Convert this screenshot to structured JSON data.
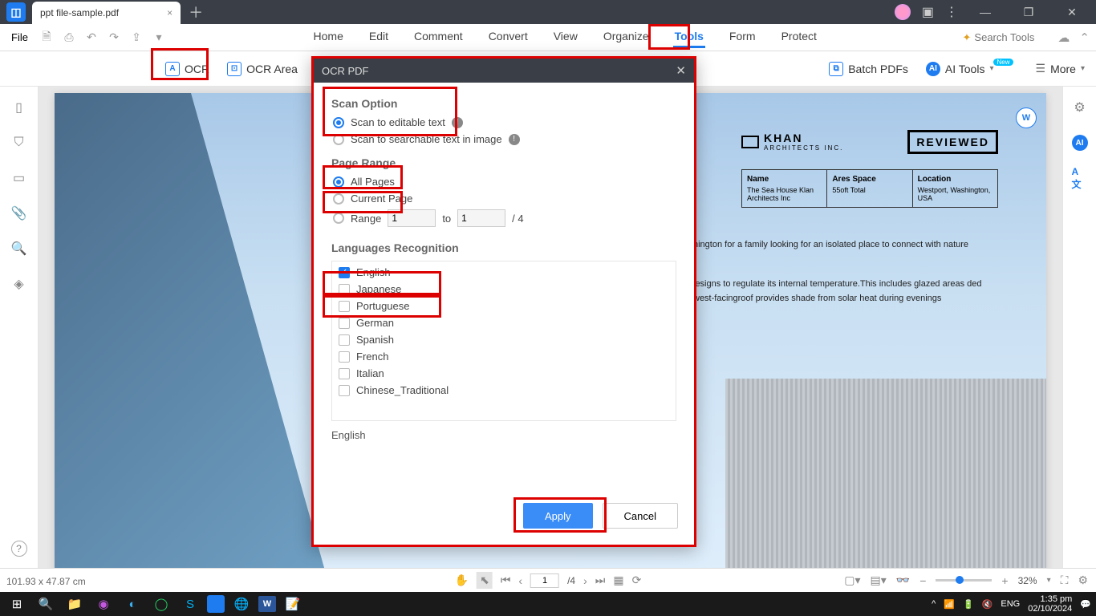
{
  "header": {
    "tab_title": "ppt file-sample.pdf",
    "search_placeholder": "Search Tools"
  },
  "menu": {
    "file": "File",
    "tabs": [
      "Home",
      "Edit",
      "Comment",
      "Convert",
      "View",
      "Organize",
      "Tools",
      "Form",
      "Protect"
    ],
    "active_tab": "Tools"
  },
  "ribbon": {
    "ocr": "OCR",
    "ocr_area": "OCR Area",
    "batch_pdfs": "Batch PDFs",
    "ai_tools": "AI Tools",
    "more": "More",
    "new_badge": "New"
  },
  "dialog": {
    "title": "OCR PDF",
    "scan_option": "Scan Option",
    "scan_editable": "Scan to editable text",
    "scan_searchable": "Scan to searchable text in image",
    "page_range": "Page Range",
    "all_pages": "All Pages",
    "current_page": "Current Page",
    "range_label": "Range",
    "range_to": "to",
    "range_total": "/ 4",
    "range_from_val": "1",
    "range_to_val": "1",
    "languages_recognition": "Languages Recognition",
    "languages": [
      "English",
      "Japanese",
      "Portuguese",
      "German",
      "Spanish",
      "French",
      "Italian",
      "Chinese_Traditional"
    ],
    "selected_lang_summary": "English",
    "apply": "Apply",
    "cancel": "Cancel"
  },
  "document": {
    "brand": "KHAN",
    "brand_sub": "ARCHITECTS INC.",
    "reviewed": "REVIEWED",
    "col1_h": "Name",
    "col1_v": "The Sea House Klan Architects Inc",
    "col2_h": "Ares Space",
    "col2_v": "55oft Total",
    "col3_h": "Location",
    "col3_v": "Westport, Washington, USA",
    "para1": "hington for a family looking for an isolated place to connect with nature",
    "para2": "lesigns to regulate its internal temperature.This includes glazed areas ded west-facingroof provides shade from solar heat during evenings",
    "word_btn": "W"
  },
  "status": {
    "dimensions": "101.93 x 47.87 cm",
    "page_current": "1",
    "page_total": "/4",
    "zoom": "32%"
  },
  "system": {
    "lang": "ENG",
    "time": "1:35 pm",
    "date": "02/10/2024"
  }
}
